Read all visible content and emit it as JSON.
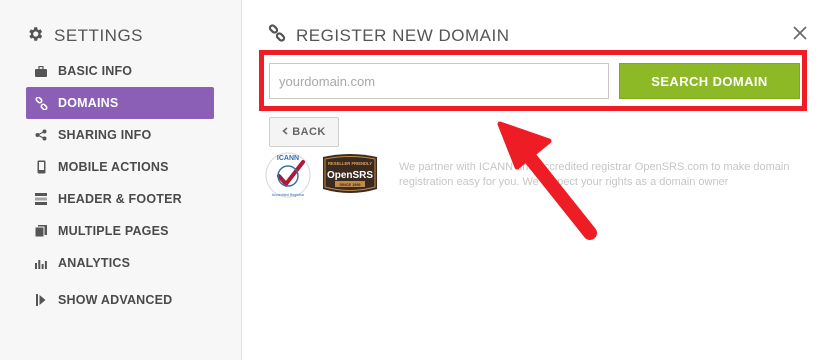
{
  "sidebar": {
    "title": "SETTINGS",
    "items": [
      {
        "label": "BASIC INFO",
        "icon": "briefcase-icon",
        "active": false
      },
      {
        "label": "DOMAINS",
        "icon": "link-icon",
        "active": true
      },
      {
        "label": "SHARING INFO",
        "icon": "share-icon",
        "active": false
      },
      {
        "label": "MOBILE ACTIONS",
        "icon": "mobile-icon",
        "active": false
      },
      {
        "label": "HEADER & FOOTER",
        "icon": "header-footer-icon",
        "active": false
      },
      {
        "label": "MULTIPLE PAGES",
        "icon": "pages-icon",
        "active": false
      },
      {
        "label": "ANALYTICS",
        "icon": "bar-chart-icon",
        "active": false
      },
      {
        "label": "SHOW ADVANCED",
        "icon": "expand-icon",
        "active": false
      }
    ]
  },
  "main": {
    "title": "REGISTER NEW DOMAIN",
    "search": {
      "placeholder": "yourdomain.com",
      "value": ""
    },
    "search_button": "SEARCH DOMAIN",
    "back_button": "BACK",
    "partner_text": "We partner with ICANN and accredited registrar OpenSRS.com to make domain registration easy for you. We respect your rights as a domain owner",
    "logos": {
      "icann": {
        "main": "ICANN",
        "sub": "Accredited Registrar"
      },
      "opensrs": {
        "top": "RESELLER FRIENDLY",
        "main": "OpenSRS",
        "bottom": "SINCE 1999"
      }
    }
  },
  "colors": {
    "accent": "#8b5fb5",
    "search_button": "#8db927",
    "highlight": "#ee1c25",
    "arrow": "#ee1c25"
  }
}
